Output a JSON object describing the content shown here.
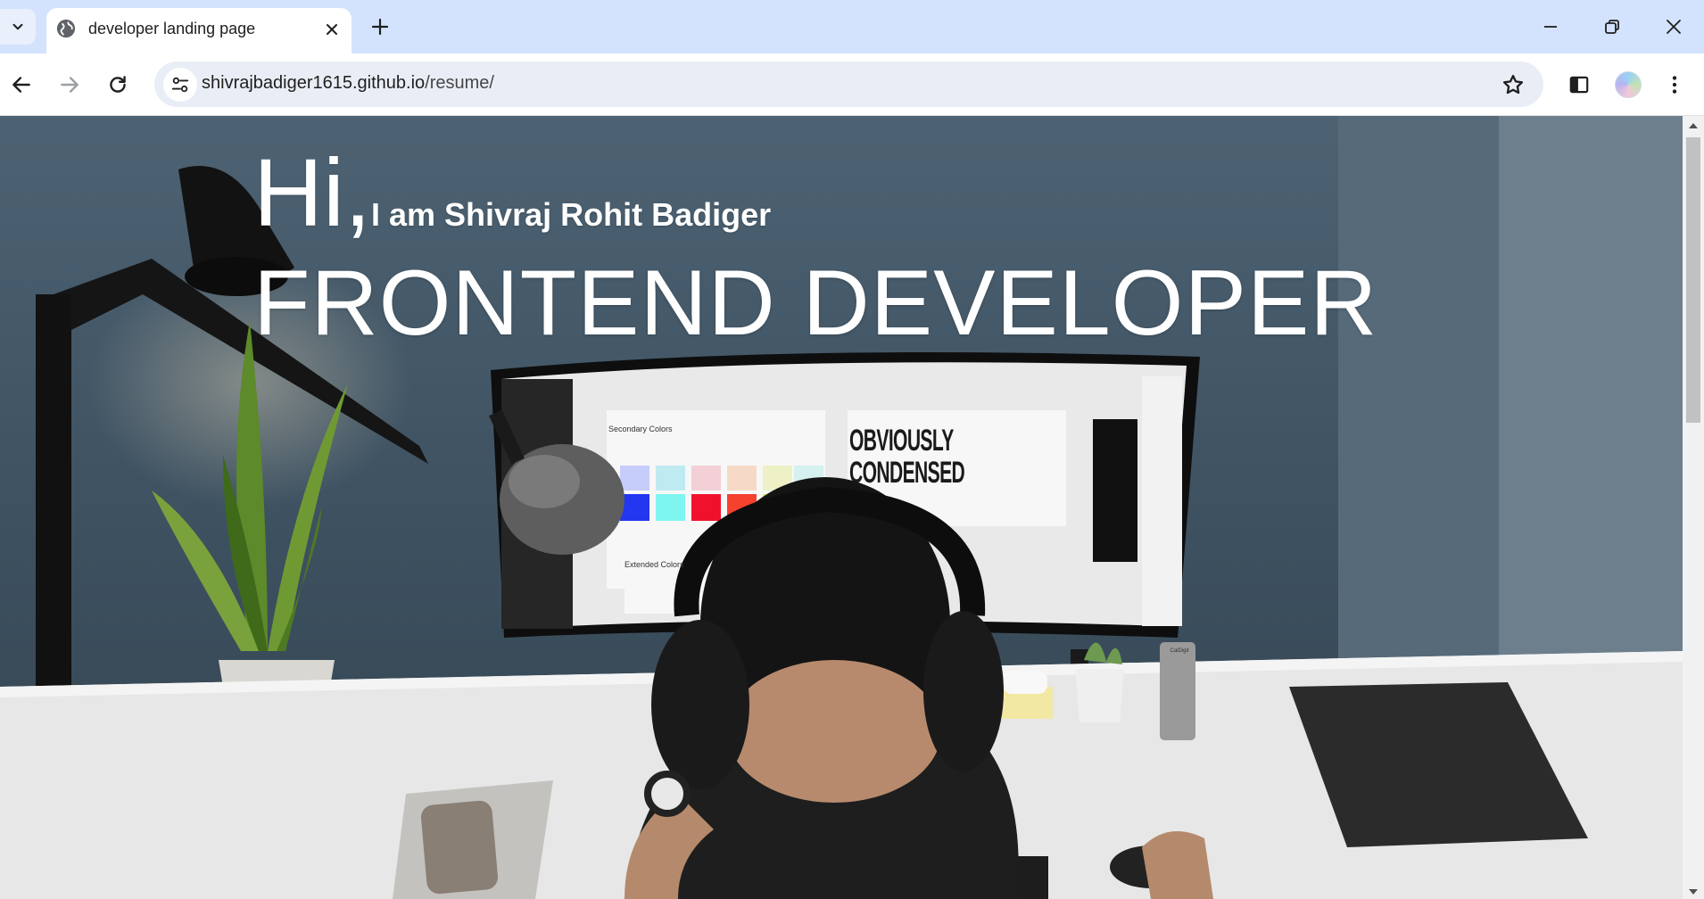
{
  "browser": {
    "tab": {
      "title": "developer landing page",
      "favicon": "globe-icon"
    },
    "address_bar": {
      "host": "shivrajbadiger1615.github.io",
      "path": "/resume/"
    },
    "icons": {
      "tab_search": "chevron-down-icon",
      "tab_close": "close-icon",
      "new_tab": "plus-icon",
      "minimize": "minimize-icon",
      "restore": "restore-icon",
      "close_window": "close-icon",
      "back": "back-arrow-icon",
      "forward": "forward-arrow-icon",
      "reload": "reload-icon",
      "site_info": "tune-icon",
      "bookmark": "star-icon",
      "side_panel": "side-panel-icon",
      "profile": "avatar",
      "menu": "more-vert-icon"
    }
  },
  "page": {
    "greeting": "Hi,",
    "intro": "I am Shivraj Rohit Badiger",
    "role": "FRONTEND DEVELOPER",
    "background_photo": {
      "monitor_heading_line1": "OBVIOUSLY",
      "monitor_heading_line2": "CONDENSED",
      "monitor_label_1": "Secondary Colors",
      "monitor_label_2": "Extended Colors",
      "hub_brand": "CalDigit"
    }
  },
  "colors": {
    "tabstrip_bg": "#d3e3fd",
    "omnibox_bg": "#e9eef6",
    "hero_text": "#ffffff",
    "scrollbar_thumb": "#c1c1c1"
  }
}
